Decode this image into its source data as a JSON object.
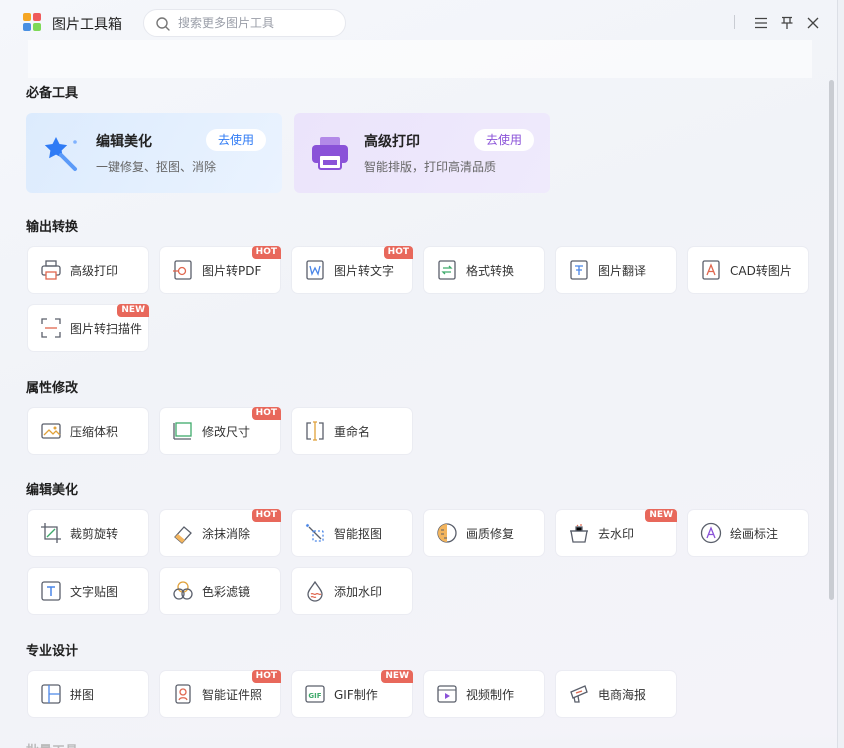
{
  "app": {
    "title": "图片工具箱"
  },
  "search": {
    "placeholder": "搜索更多图片工具",
    "icon": "search-icon"
  },
  "window_controls": [
    {
      "name": "menu-icon"
    },
    {
      "name": "pin-icon"
    },
    {
      "name": "close-icon"
    }
  ],
  "sections": {
    "essential": {
      "title": "必备工具",
      "cards": [
        {
          "title": "编辑美化",
          "desc": "一键修复、抠图、消除",
          "button": "去使用",
          "icon": "magic-wand-icon",
          "accent": "#2f7bf5"
        },
        {
          "title": "高级打印",
          "desc": "智能排版，打印高清品质",
          "button": "去使用",
          "icon": "printer-icon",
          "accent": "#8a52d8"
        }
      ]
    },
    "output": {
      "title": "输出转换",
      "tools": [
        {
          "label": "高级打印",
          "icon": "printer-icon",
          "badge": ""
        },
        {
          "label": "图片转PDF",
          "icon": "pdf-icon",
          "badge": "HOT"
        },
        {
          "label": "图片转文字",
          "icon": "text-recognition-icon",
          "badge": "HOT"
        },
        {
          "label": "格式转换",
          "icon": "format-convert-icon",
          "badge": ""
        },
        {
          "label": "图片翻译",
          "icon": "translate-icon",
          "badge": ""
        },
        {
          "label": "CAD转图片",
          "icon": "cad-icon",
          "badge": ""
        },
        {
          "label": "图片转扫描件",
          "icon": "scan-icon",
          "badge": "NEW"
        }
      ]
    },
    "attributes": {
      "title": "属性修改",
      "tools": [
        {
          "label": "压缩体积",
          "icon": "compress-icon",
          "badge": ""
        },
        {
          "label": "修改尺寸",
          "icon": "resize-icon",
          "badge": "HOT"
        },
        {
          "label": "重命名",
          "icon": "rename-icon",
          "badge": ""
        }
      ]
    },
    "edit": {
      "title": "编辑美化",
      "tools": [
        {
          "label": "裁剪旋转",
          "icon": "crop-icon",
          "badge": ""
        },
        {
          "label": "涂抹消除",
          "icon": "eraser-icon",
          "badge": "HOT"
        },
        {
          "label": "智能抠图",
          "icon": "cutout-icon",
          "badge": ""
        },
        {
          "label": "画质修复",
          "icon": "quality-repair-icon",
          "badge": ""
        },
        {
          "label": "去水印",
          "icon": "remove-watermark-icon",
          "badge": "NEW"
        },
        {
          "label": "绘画标注",
          "icon": "annotate-icon",
          "badge": ""
        },
        {
          "label": "文字贴图",
          "icon": "text-sticker-icon",
          "badge": ""
        },
        {
          "label": "色彩滤镜",
          "icon": "color-filter-icon",
          "badge": ""
        },
        {
          "label": "添加水印",
          "icon": "add-watermark-icon",
          "badge": ""
        }
      ]
    },
    "design": {
      "title": "专业设计",
      "tools": [
        {
          "label": "拼图",
          "icon": "collage-icon",
          "badge": ""
        },
        {
          "label": "智能证件照",
          "icon": "id-photo-icon",
          "badge": "HOT"
        },
        {
          "label": "GIF制作",
          "icon": "gif-icon",
          "badge": "NEW"
        },
        {
          "label": "视频制作",
          "icon": "video-icon",
          "badge": ""
        },
        {
          "label": "电商海报",
          "icon": "poster-icon",
          "badge": ""
        }
      ]
    },
    "batch": {
      "title": "批量工具"
    }
  },
  "colors": {
    "hot_badge": "#e8685b",
    "new_badge": "#e8685b",
    "icon_stroke": "#5a5f6b",
    "icon_accent": "#e0674f"
  }
}
